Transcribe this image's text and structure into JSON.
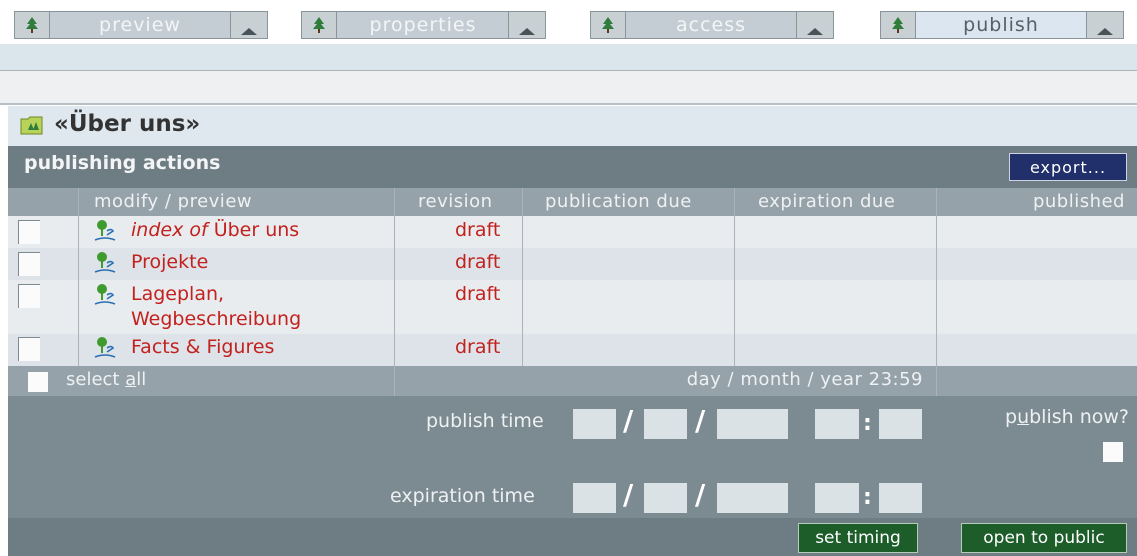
{
  "tabs": [
    {
      "label": "preview"
    },
    {
      "label": "properties"
    },
    {
      "label": "access"
    },
    {
      "label": "publish"
    }
  ],
  "folder": {
    "title": "«Über uns»"
  },
  "actions": {
    "label": "publishing actions",
    "export_label": "export..."
  },
  "columns": {
    "modify": "modify / preview",
    "revision": "revision",
    "publication_due": "publication due",
    "expiration_due": "expiration due",
    "published": "published"
  },
  "rows": [
    {
      "name_prefix": "index of",
      "name": "Über uns",
      "revision": "draft"
    },
    {
      "name": "Projekte",
      "revision": "draft"
    },
    {
      "name_line1": "Lageplan,",
      "name_line2": "Wegbeschreibung",
      "revision": "draft"
    },
    {
      "name": "Facts & Figures",
      "revision": "draft"
    }
  ],
  "select_all": {
    "prefix": "select ",
    "underlined": "a",
    "suffix": "ll"
  },
  "date_format": "day / month / year  23:59",
  "timing": {
    "publish_label": "publish time",
    "expiration_label": "expiration time",
    "publish_now": {
      "prefix": "p",
      "underlined": "u",
      "suffix": "blish now?"
    }
  },
  "buttons": {
    "set_timing": "set timing",
    "open_to_public": "open to public"
  },
  "colors": {
    "accent_link": "#c3211d",
    "export_button": "#21306b",
    "action_button": "#1c5d2a",
    "header_bar": "#6e7c83"
  }
}
